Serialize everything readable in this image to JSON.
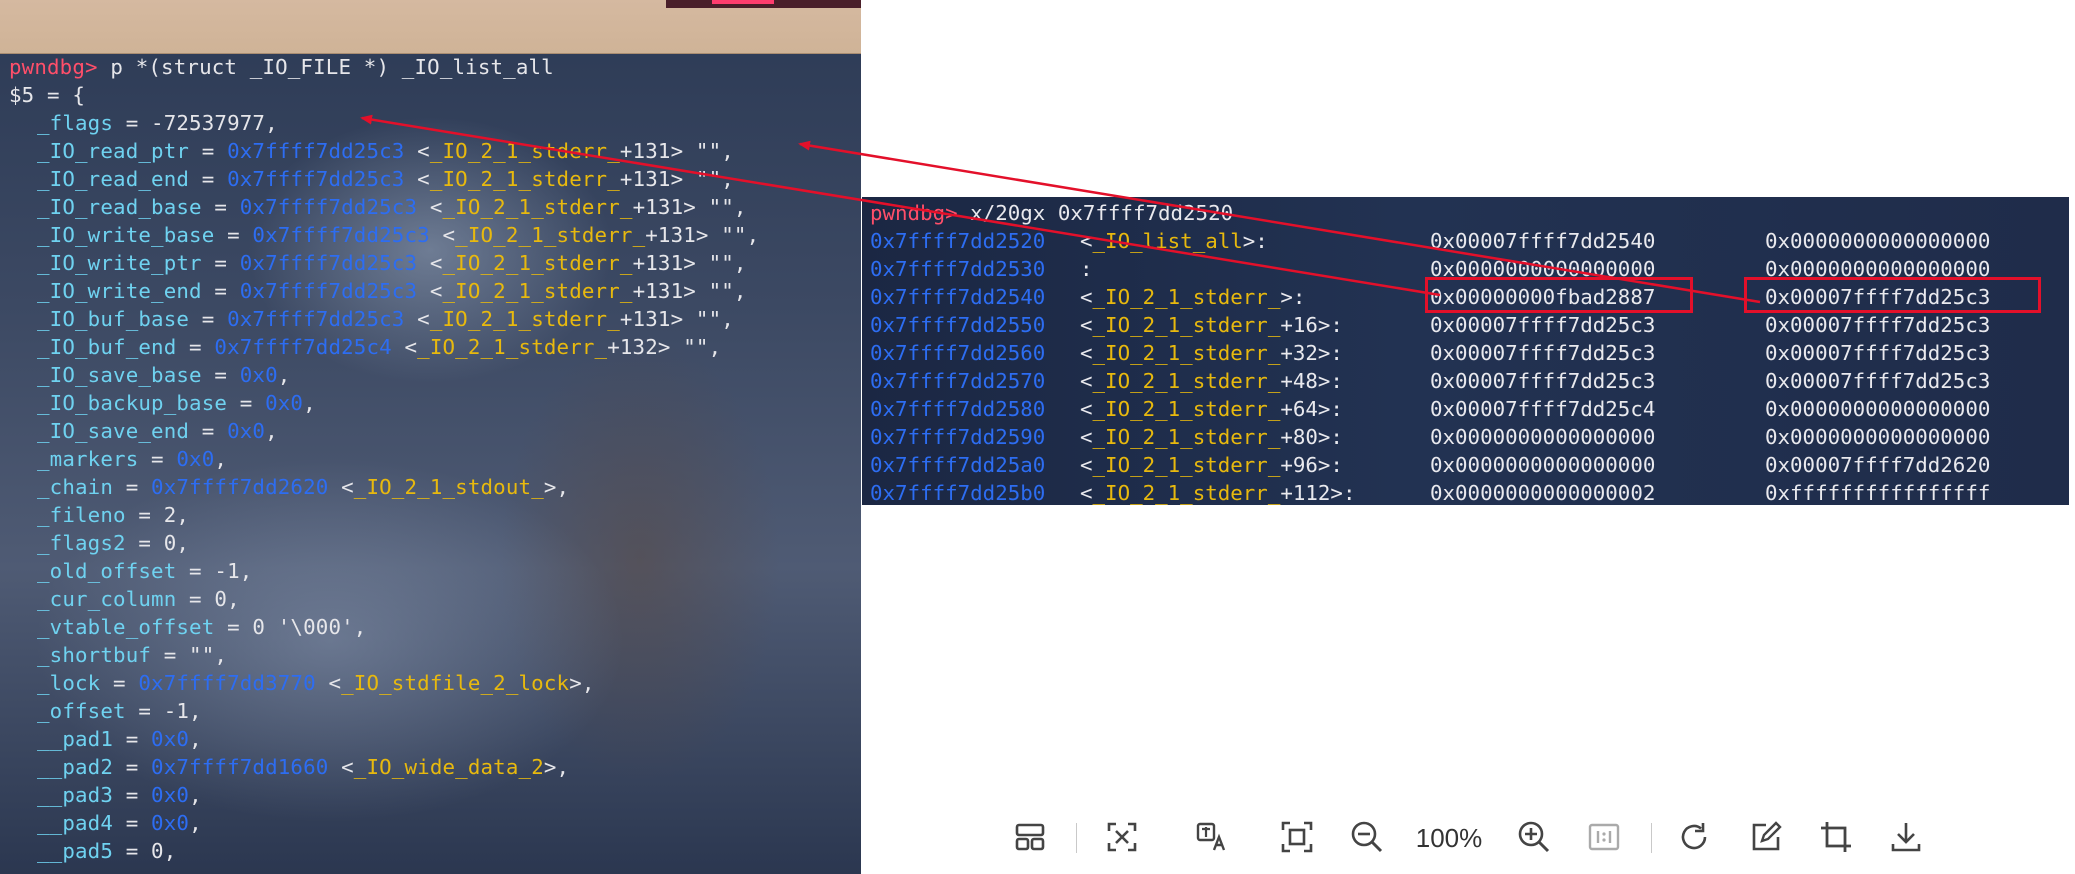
{
  "left_terminal": {
    "prompt": "pwndbg>",
    "command": " p *(struct _IO_FILE *) _IO_list_all",
    "lines": [
      {
        "segs": [
          {
            "t": "$5 = {",
            "c": ""
          }
        ]
      },
      {
        "ind": true,
        "segs": [
          {
            "t": "_flags",
            "c": "fld"
          },
          {
            "t": " = -72537977,",
            "c": ""
          }
        ]
      },
      {
        "ind": true,
        "segs": [
          {
            "t": "_IO_read_ptr",
            "c": "fld"
          },
          {
            "t": " = ",
            "c": ""
          },
          {
            "t": "0x7ffff7dd25c3",
            "c": "addr"
          },
          {
            "t": " <",
            "c": ""
          },
          {
            "t": "_IO_2_1_stderr_",
            "c": "sym"
          },
          {
            "t": "+131> \"\",",
            "c": ""
          }
        ]
      },
      {
        "ind": true,
        "segs": [
          {
            "t": "_IO_read_end",
            "c": "fld"
          },
          {
            "t": " = ",
            "c": ""
          },
          {
            "t": "0x7ffff7dd25c3",
            "c": "addr"
          },
          {
            "t": " <",
            "c": ""
          },
          {
            "t": "_IO_2_1_stderr_",
            "c": "sym"
          },
          {
            "t": "+131> \"\",",
            "c": ""
          }
        ]
      },
      {
        "ind": true,
        "segs": [
          {
            "t": "_IO_read_base",
            "c": "fld"
          },
          {
            "t": " = ",
            "c": ""
          },
          {
            "t": "0x7ffff7dd25c3",
            "c": "addr"
          },
          {
            "t": " <",
            "c": ""
          },
          {
            "t": "_IO_2_1_stderr_",
            "c": "sym"
          },
          {
            "t": "+131> \"\",",
            "c": ""
          }
        ]
      },
      {
        "ind": true,
        "segs": [
          {
            "t": "_IO_write_base",
            "c": "fld"
          },
          {
            "t": " = ",
            "c": ""
          },
          {
            "t": "0x7ffff7dd25c3",
            "c": "addr"
          },
          {
            "t": " <",
            "c": ""
          },
          {
            "t": "_IO_2_1_stderr_",
            "c": "sym"
          },
          {
            "t": "+131> \"\",",
            "c": ""
          }
        ]
      },
      {
        "ind": true,
        "segs": [
          {
            "t": "_IO_write_ptr",
            "c": "fld"
          },
          {
            "t": " = ",
            "c": ""
          },
          {
            "t": "0x7ffff7dd25c3",
            "c": "addr"
          },
          {
            "t": " <",
            "c": ""
          },
          {
            "t": "_IO_2_1_stderr_",
            "c": "sym"
          },
          {
            "t": "+131> \"\",",
            "c": ""
          }
        ]
      },
      {
        "ind": true,
        "segs": [
          {
            "t": "_IO_write_end",
            "c": "fld"
          },
          {
            "t": " = ",
            "c": ""
          },
          {
            "t": "0x7ffff7dd25c3",
            "c": "addr"
          },
          {
            "t": " <",
            "c": ""
          },
          {
            "t": "_IO_2_1_stderr_",
            "c": "sym"
          },
          {
            "t": "+131> \"\",",
            "c": ""
          }
        ]
      },
      {
        "ind": true,
        "segs": [
          {
            "t": "_IO_buf_base",
            "c": "fld"
          },
          {
            "t": " = ",
            "c": ""
          },
          {
            "t": "0x7ffff7dd25c3",
            "c": "addr"
          },
          {
            "t": " <",
            "c": ""
          },
          {
            "t": "_IO_2_1_stderr_",
            "c": "sym"
          },
          {
            "t": "+131> \"\",",
            "c": ""
          }
        ]
      },
      {
        "ind": true,
        "segs": [
          {
            "t": "_IO_buf_end",
            "c": "fld"
          },
          {
            "t": " = ",
            "c": ""
          },
          {
            "t": "0x7ffff7dd25c4",
            "c": "addr"
          },
          {
            "t": " <",
            "c": ""
          },
          {
            "t": "_IO_2_1_stderr_",
            "c": "sym"
          },
          {
            "t": "+132> \"\",",
            "c": ""
          }
        ]
      },
      {
        "ind": true,
        "segs": [
          {
            "t": "_IO_save_base",
            "c": "fld"
          },
          {
            "t": " = ",
            "c": ""
          },
          {
            "t": "0x0",
            "c": "addr"
          },
          {
            "t": ",",
            "c": ""
          }
        ]
      },
      {
        "ind": true,
        "segs": [
          {
            "t": "_IO_backup_base",
            "c": "fld"
          },
          {
            "t": " = ",
            "c": ""
          },
          {
            "t": "0x0",
            "c": "addr"
          },
          {
            "t": ",",
            "c": ""
          }
        ]
      },
      {
        "ind": true,
        "segs": [
          {
            "t": "_IO_save_end",
            "c": "fld"
          },
          {
            "t": " = ",
            "c": ""
          },
          {
            "t": "0x0",
            "c": "addr"
          },
          {
            "t": ",",
            "c": ""
          }
        ]
      },
      {
        "ind": true,
        "segs": [
          {
            "t": "_markers",
            "c": "fld"
          },
          {
            "t": " = ",
            "c": ""
          },
          {
            "t": "0x0",
            "c": "addr"
          },
          {
            "t": ",",
            "c": ""
          }
        ]
      },
      {
        "ind": true,
        "segs": [
          {
            "t": "_chain",
            "c": "fld"
          },
          {
            "t": " = ",
            "c": ""
          },
          {
            "t": "0x7ffff7dd2620",
            "c": "addr"
          },
          {
            "t": " <",
            "c": ""
          },
          {
            "t": "_IO_2_1_stdout_",
            "c": "sym"
          },
          {
            "t": ">,",
            "c": ""
          }
        ]
      },
      {
        "ind": true,
        "segs": [
          {
            "t": "_fileno",
            "c": "fld"
          },
          {
            "t": " = 2,",
            "c": ""
          }
        ]
      },
      {
        "ind": true,
        "segs": [
          {
            "t": "_flags2",
            "c": "fld"
          },
          {
            "t": " = 0,",
            "c": ""
          }
        ]
      },
      {
        "ind": true,
        "segs": [
          {
            "t": "_old_offset",
            "c": "fld"
          },
          {
            "t": " = -1,",
            "c": ""
          }
        ]
      },
      {
        "ind": true,
        "segs": [
          {
            "t": "_cur_column",
            "c": "fld"
          },
          {
            "t": " = 0,",
            "c": ""
          }
        ]
      },
      {
        "ind": true,
        "segs": [
          {
            "t": "_vtable_offset",
            "c": "fld"
          },
          {
            "t": " = 0 '\\000',",
            "c": ""
          }
        ]
      },
      {
        "ind": true,
        "segs": [
          {
            "t": "_shortbuf",
            "c": "fld"
          },
          {
            "t": " = \"\",",
            "c": ""
          }
        ]
      },
      {
        "ind": true,
        "segs": [
          {
            "t": "_lock",
            "c": "fld"
          },
          {
            "t": " = ",
            "c": ""
          },
          {
            "t": "0x7ffff7dd3770",
            "c": "addr"
          },
          {
            "t": " <",
            "c": ""
          },
          {
            "t": "_IO_stdfile_2_lock",
            "c": "sym"
          },
          {
            "t": ">,",
            "c": ""
          }
        ]
      },
      {
        "ind": true,
        "segs": [
          {
            "t": "_offset",
            "c": "fld"
          },
          {
            "t": " = -1,",
            "c": ""
          }
        ]
      },
      {
        "ind": true,
        "segs": [
          {
            "t": "__pad1",
            "c": "fld"
          },
          {
            "t": " = ",
            "c": ""
          },
          {
            "t": "0x0",
            "c": "addr"
          },
          {
            "t": ",",
            "c": ""
          }
        ]
      },
      {
        "ind": true,
        "segs": [
          {
            "t": "__pad2",
            "c": "fld"
          },
          {
            "t": " = ",
            "c": ""
          },
          {
            "t": "0x7ffff7dd1660",
            "c": "addr"
          },
          {
            "t": " <",
            "c": ""
          },
          {
            "t": "_IO_wide_data_2",
            "c": "sym"
          },
          {
            "t": ">,",
            "c": ""
          }
        ]
      },
      {
        "ind": true,
        "segs": [
          {
            "t": "__pad3",
            "c": "fld"
          },
          {
            "t": " = ",
            "c": ""
          },
          {
            "t": "0x0",
            "c": "addr"
          },
          {
            "t": ",",
            "c": ""
          }
        ]
      },
      {
        "ind": true,
        "segs": [
          {
            "t": "__pad4",
            "c": "fld"
          },
          {
            "t": " = ",
            "c": ""
          },
          {
            "t": "0x0",
            "c": "addr"
          },
          {
            "t": ",",
            "c": ""
          }
        ]
      },
      {
        "ind": true,
        "segs": [
          {
            "t": "__pad5",
            "c": "fld"
          },
          {
            "t": " = 0,",
            "c": ""
          }
        ]
      }
    ]
  },
  "right_terminal": {
    "prompt": "pwndbg>",
    "command": " x/20gx 0x7ffff7dd2520",
    "rows": [
      {
        "addr": "0x7ffff7dd2520",
        "sym": "<_IO_list_all>:",
        "v1": "0x00007ffff7dd2540",
        "v2": "0x0000000000000000"
      },
      {
        "addr": "0x7ffff7dd2530",
        "sym": ":",
        "v1": "0x0000000000000000",
        "v2": "0x0000000000000000"
      },
      {
        "addr": "0x7ffff7dd2540",
        "sym": "<_IO_2_1_stderr_>:",
        "v1": "0x00000000fbad2887",
        "v2": "0x00007ffff7dd25c3"
      },
      {
        "addr": "0x7ffff7dd2550",
        "sym": "<_IO_2_1_stderr_+16>:",
        "v1": "0x00007ffff7dd25c3",
        "v2": "0x00007ffff7dd25c3"
      },
      {
        "addr": "0x7ffff7dd2560",
        "sym": "<_IO_2_1_stderr_+32>:",
        "v1": "0x00007ffff7dd25c3",
        "v2": "0x00007ffff7dd25c3"
      },
      {
        "addr": "0x7ffff7dd2570",
        "sym": "<_IO_2_1_stderr_+48>:",
        "v1": "0x00007ffff7dd25c3",
        "v2": "0x00007ffff7dd25c3"
      },
      {
        "addr": "0x7ffff7dd2580",
        "sym": "<_IO_2_1_stderr_+64>:",
        "v1": "0x00007ffff7dd25c4",
        "v2": "0x0000000000000000"
      },
      {
        "addr": "0x7ffff7dd2590",
        "sym": "<_IO_2_1_stderr_+80>:",
        "v1": "0x0000000000000000",
        "v2": "0x0000000000000000"
      },
      {
        "addr": "0x7ffff7dd25a0",
        "sym": "<_IO_2_1_stderr_+96>:",
        "v1": "0x0000000000000000",
        "v2": "0x00007ffff7dd2620"
      },
      {
        "addr": "0x7ffff7dd25b0",
        "sym": "<_IO_2_1_stderr_+112>:",
        "v1": "0x0000000000000002",
        "v2": "0xffffffffffffffff"
      }
    ],
    "highlighted": [
      "0x00000000fbad2887",
      "0x00007ffff7dd25c3"
    ]
  },
  "colors": {
    "prompt": "#ff4f6a",
    "address": "#2d6df2",
    "symbol": "#e8b90e",
    "field": "#6fd2f0",
    "highlight": "#e3102a"
  },
  "toolbar": {
    "zoom_label": "100%",
    "icons": [
      "layout-icon",
      "select-area-icon",
      "translate-icon",
      "fit-screen-icon",
      "zoom-out-icon",
      "zoom-in-icon",
      "actual-size-icon",
      "rotate-icon",
      "edit-icon",
      "crop-icon",
      "download-icon"
    ]
  }
}
